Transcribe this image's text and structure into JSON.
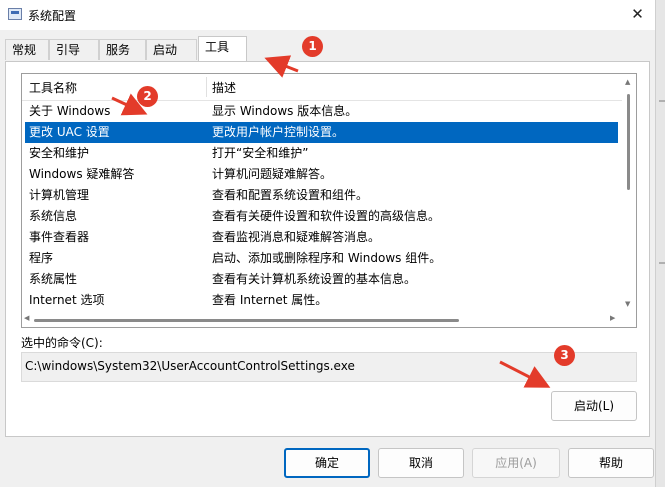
{
  "window": {
    "title": "系统配置",
    "close_glyph": "✕"
  },
  "tabs": [
    {
      "label": "常规",
      "active": false
    },
    {
      "label": "引导",
      "active": false
    },
    {
      "label": "服务",
      "active": false
    },
    {
      "label": "启动",
      "active": false
    },
    {
      "label": "工具",
      "active": true
    }
  ],
  "tools_list": {
    "columns": [
      "工具名称",
      "描述"
    ],
    "selected_index": 1,
    "rows": [
      {
        "name": "关于 Windows",
        "desc": "显示 Windows 版本信息。"
      },
      {
        "name": "更改 UAC 设置",
        "desc": "更改用户帐户控制设置。"
      },
      {
        "name": "安全和维护",
        "desc": "打开“安全和维护”"
      },
      {
        "name": "Windows 疑难解答",
        "desc": "计算机问题疑难解答。"
      },
      {
        "name": "计算机管理",
        "desc": "查看和配置系统设置和组件。"
      },
      {
        "name": "系统信息",
        "desc": "查看有关硬件设置和软件设置的高级信息。"
      },
      {
        "name": "事件查看器",
        "desc": "查看监视消息和疑难解答消息。"
      },
      {
        "name": "程序",
        "desc": "启动、添加或删除程序和 Windows 组件。"
      },
      {
        "name": "系统属性",
        "desc": "查看有关计算机系统设置的基本信息。"
      },
      {
        "name": "Internet 选项",
        "desc": "查看 Internet 属性。"
      }
    ]
  },
  "selected_command": {
    "label": "选中的命令(C):",
    "value": "C:\\windows\\System32\\UserAccountControlSettings.exe"
  },
  "buttons": {
    "launch": "启动(L)",
    "ok": "确定",
    "cancel": "取消",
    "apply": "应用(A)",
    "help": "帮助"
  },
  "annotations": [
    {
      "number": "1"
    },
    {
      "number": "2"
    },
    {
      "number": "3"
    }
  ],
  "colors": {
    "selection": "#0067c0",
    "annotation": "#e33b2a"
  }
}
